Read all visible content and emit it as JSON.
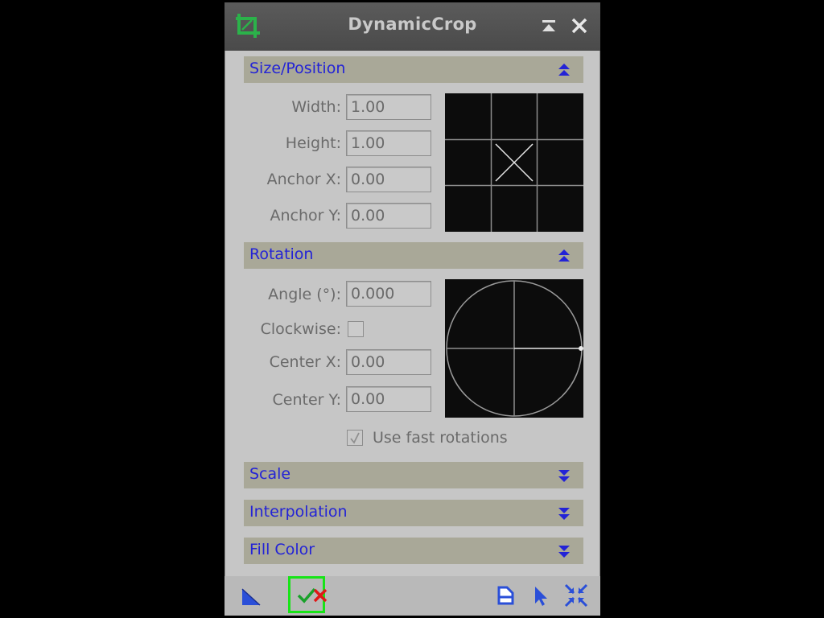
{
  "window": {
    "title": "DynamicCrop",
    "icon": "crop-icon",
    "controls": [
      "shade-icon",
      "close-icon"
    ]
  },
  "sections": {
    "size_position": {
      "title": "Size/Position",
      "expanded": true,
      "fields": {
        "width": {
          "label": "Width:",
          "value": "1.00"
        },
        "height": {
          "label": "Height:",
          "value": "1.00"
        },
        "anchor_x": {
          "label": "Anchor X:",
          "value": "0.00"
        },
        "anchor_y": {
          "label": "Anchor Y:",
          "value": "0.00"
        }
      }
    },
    "rotation": {
      "title": "Rotation",
      "expanded": true,
      "fields": {
        "angle": {
          "label": "Angle (°):",
          "value": "0.000"
        },
        "clockwise": {
          "label": "Clockwise:",
          "checked": false
        },
        "center_x": {
          "label": "Center X:",
          "value": "0.00"
        },
        "center_y": {
          "label": "Center Y:",
          "value": "0.00"
        }
      },
      "fast_rotations": {
        "label": "Use fast rotations",
        "checked": true,
        "enabled": false
      }
    },
    "scale": {
      "title": "Scale",
      "expanded": false
    },
    "interpolation": {
      "title": "Interpolation",
      "expanded": false
    },
    "fill_color": {
      "title": "Fill Color",
      "expanded": false
    }
  },
  "bottom_bar": {
    "left": [
      "new-instance-icon",
      "apply-icon",
      "cancel-icon"
    ],
    "right": [
      "reset-icon",
      "cursor-icon",
      "preview-toggle-icon"
    ]
  },
  "colors": {
    "section_title": "#2323d6",
    "crop_icon": "#2bb24a",
    "apply_check": "#19a12a",
    "cancel_x": "#e01818",
    "apply_highlight": "#17e417"
  }
}
